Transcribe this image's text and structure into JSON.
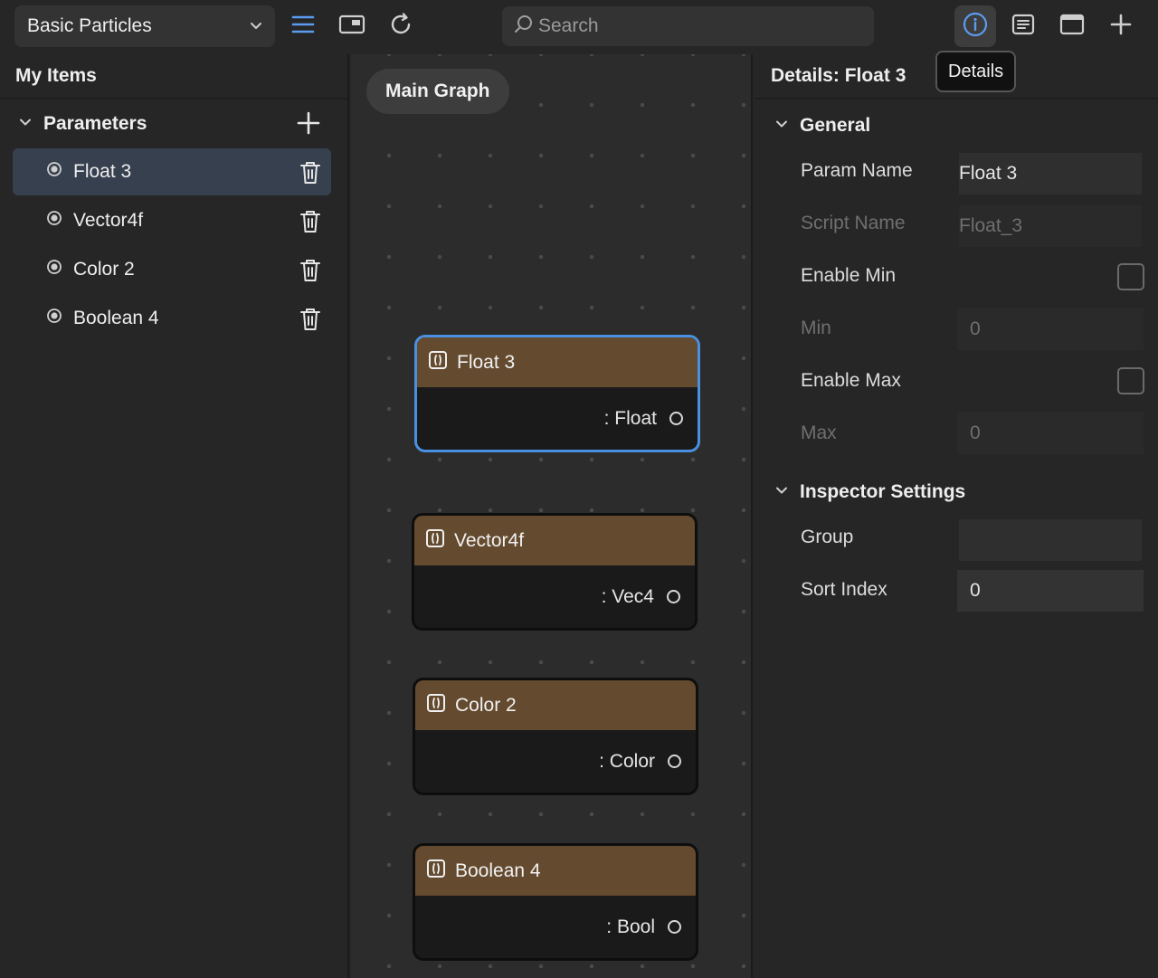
{
  "toolbar": {
    "project_name": "Basic Particles",
    "search_placeholder": "Search",
    "tooltip": "Details",
    "icons": [
      "list-icon",
      "panel-icon",
      "refresh-icon",
      "info-icon",
      "details-list-icon",
      "window-icon",
      "plus-icon"
    ],
    "accent_color": "#5b9bf0"
  },
  "left": {
    "title": "My Items",
    "section": "Parameters",
    "params": [
      {
        "label": "Float 3",
        "selected": true
      },
      {
        "label": "Vector4f",
        "selected": false
      },
      {
        "label": "Color 2",
        "selected": false
      },
      {
        "label": "Boolean 4",
        "selected": false
      }
    ]
  },
  "graph": {
    "tab": "Main Graph",
    "nodes": [
      {
        "title": "Float 3",
        "output": ": Float",
        "selected": true
      },
      {
        "title": "Vector4f",
        "output": ": Vec4",
        "selected": false
      },
      {
        "title": "Color 2",
        "output": ": Color",
        "selected": false
      },
      {
        "title": "Boolean 4",
        "output": ": Bool",
        "selected": false
      }
    ],
    "node_header_color": "#644a2e",
    "selection_color": "#4a90e2"
  },
  "details": {
    "title": "Details:  Float 3",
    "general": {
      "header": "General",
      "param_name_label": "Param Name",
      "param_name_value": "Float 3",
      "script_name_label": "Script Name",
      "script_name_value": "Float_3",
      "enable_min_label": "Enable Min",
      "enable_min_checked": false,
      "min_label": "Min",
      "min_value": "0",
      "enable_max_label": "Enable Max",
      "enable_max_checked": false,
      "max_label": "Max",
      "max_value": "0"
    },
    "inspector": {
      "header": "Inspector Settings",
      "group_label": "Group",
      "group_value": "",
      "sort_index_label": "Sort Index",
      "sort_index_value": "0"
    }
  }
}
